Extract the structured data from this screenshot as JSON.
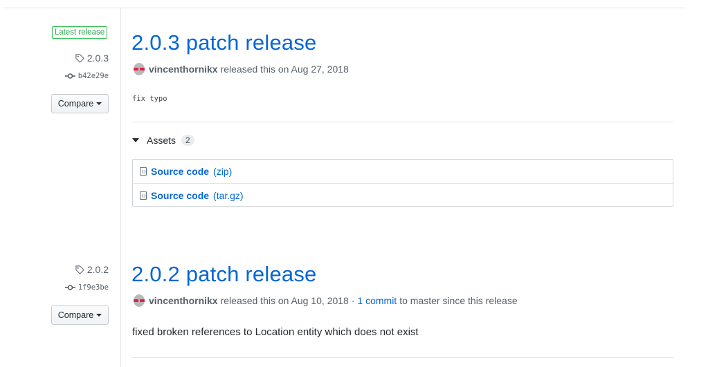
{
  "releases": [
    {
      "latest_badge": "Latest release",
      "tag": "2.0.3",
      "commit": "b42e29e",
      "compare_label": "Compare",
      "title": "2.0.3 patch release",
      "author": "vincenthornikx",
      "released_text": "released this on Aug 27, 2018",
      "notes": "fix typo",
      "assets_label": "Assets",
      "assets_count": "2",
      "assets": [
        {
          "name": "Source code",
          "ext": "(zip)"
        },
        {
          "name": "Source code",
          "ext": "(tar.gz)"
        }
      ]
    },
    {
      "tag": "2.0.2",
      "commit": "1f9e3be",
      "compare_label": "Compare",
      "title": "2.0.2 patch release",
      "author": "vincenthornikx",
      "released_text": "released this on Aug 10, 2018 ·",
      "commits_link": "1 commit",
      "commits_suffix": "to master since this release",
      "notes": "fixed broken references to Location entity which does not exist"
    }
  ]
}
